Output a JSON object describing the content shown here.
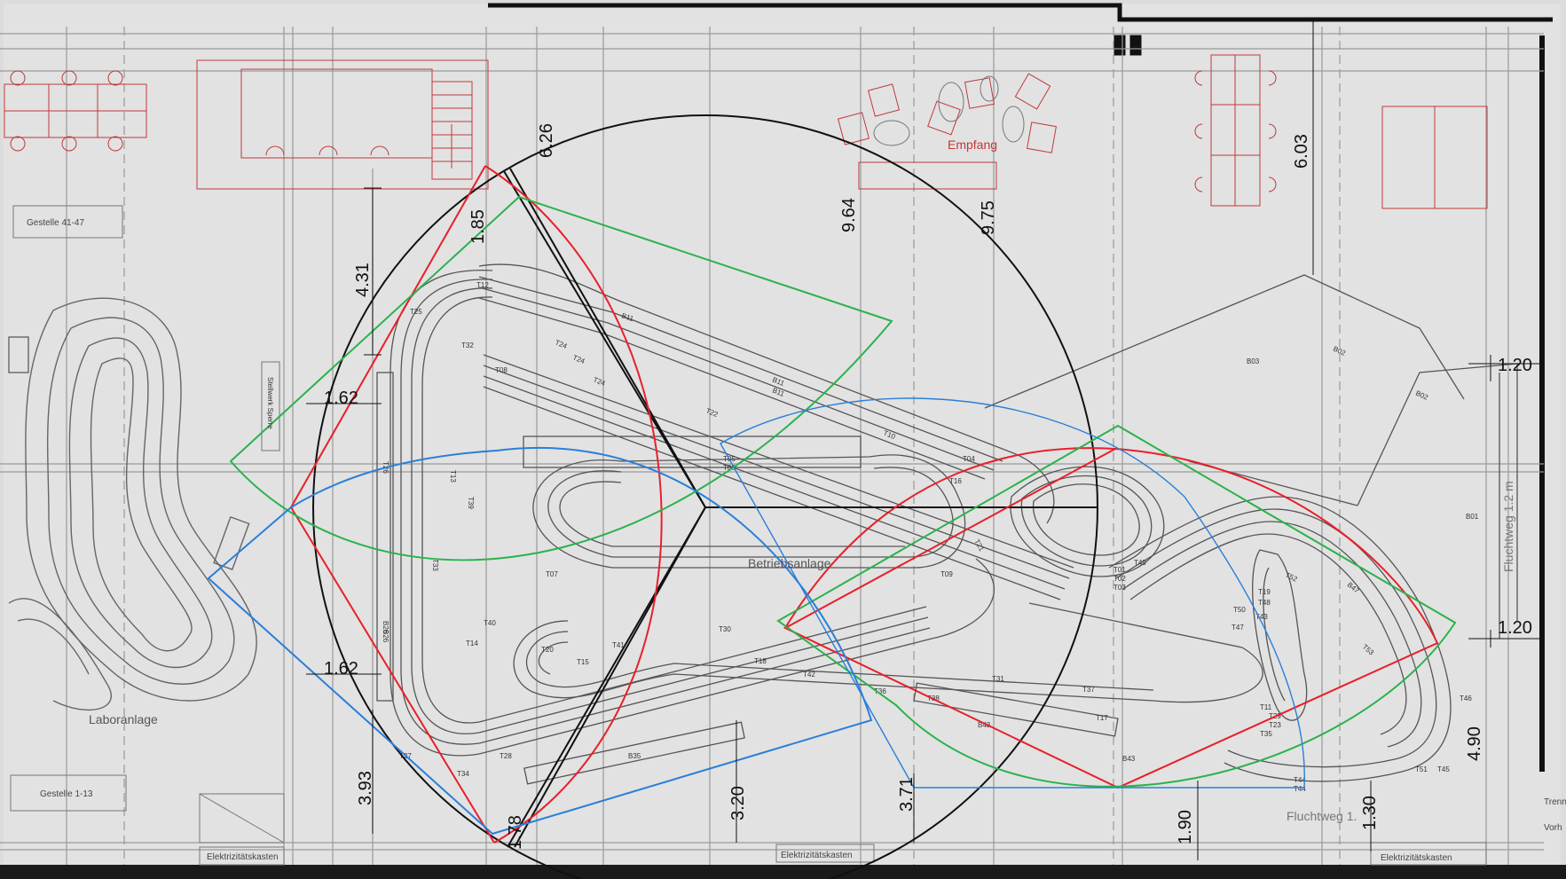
{
  "labels": {
    "empfang": "Empfang",
    "betriebsanlage": "Betriebsanlage",
    "laboranlage": "Laboranlage",
    "gestelle_41_47": "Gestelle 41-47",
    "gestelle_1_13": "Gestelle 1-13",
    "elektro_1": "Elektrizitätskasten",
    "elektro_2": "Elektrizitätskasten",
    "elektro_3": "Elektrizitätskasten",
    "fluchtweg_right": "Fluchtweg 1.2 m",
    "fluchtweg_bottom": "Fluchtweg 1.",
    "trenn": "Trenn",
    "vorh": "Vorh",
    "stellwerk": "Stellwerk Sperre"
  },
  "dimensions": [
    "6.26",
    "1.85",
    "4.31",
    "1.62",
    "1.62",
    "9.64",
    "9.75",
    "6.03",
    "1.20",
    "1.20",
    "3.93",
    "1.78",
    "3.20",
    "3.71",
    "1.90",
    "1.30",
    "4.90"
  ],
  "track_labels": [
    "T12",
    "T25",
    "T32",
    "T08",
    "B11",
    "T24",
    "T24",
    "T24",
    "B11",
    "B11",
    "T22",
    "T10",
    "T05",
    "T06",
    "T04",
    "T16",
    "T09",
    "T21",
    "T13",
    "T33",
    "T39",
    "T40",
    "T14",
    "T20",
    "T15",
    "T41",
    "T30",
    "T18",
    "T42",
    "T31",
    "T37",
    "T17",
    "B35",
    "T27",
    "T34",
    "T28",
    "T26",
    "B43",
    "B43",
    "T36",
    "B03",
    "B02",
    "B02",
    "B01",
    "T52",
    "B47",
    "T53",
    "T19",
    "T46",
    "T51",
    "T45",
    "T44",
    "T44",
    "T01",
    "T02",
    "T03",
    "T49",
    "T48",
    "T11",
    "T29",
    "B26",
    "B26",
    "T07",
    "T23",
    "T35",
    "T50",
    "T43",
    "T38",
    "T47"
  ],
  "overlay_colors": {
    "black": "#111111",
    "red": "#e8202a",
    "green": "#2bb24c",
    "blue": "#2a7fd8",
    "plan": "#5a5a5a",
    "furniture": "#c0393b"
  }
}
